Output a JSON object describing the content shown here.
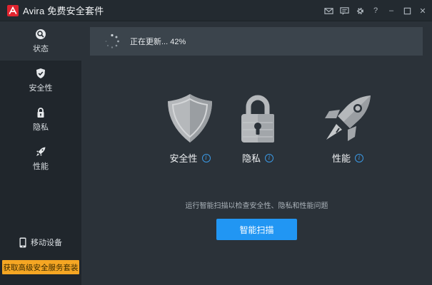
{
  "app": {
    "title": "Avira 免费安全套件",
    "brand_color": "#e0242f",
    "accent_color": "#2196f3"
  },
  "titlebar": {
    "controls": [
      "mail-icon",
      "chat-icon",
      "gear-icon",
      "help",
      "minimize",
      "maximize",
      "close"
    ],
    "help_label": "?",
    "minimize_label": "–",
    "close_label": "✕"
  },
  "sidebar": {
    "items": [
      {
        "label": "状态",
        "icon": "status-icon",
        "active": true
      },
      {
        "label": "安全性",
        "icon": "shield-check-icon",
        "active": false
      },
      {
        "label": "隐私",
        "icon": "lock-icon",
        "active": false
      },
      {
        "label": "性能",
        "icon": "rocket-icon",
        "active": false
      }
    ],
    "mobile_label": "移动设备",
    "upgrade_label": "获取高级安全服务套装"
  },
  "main": {
    "status_text": "正在更新... 42%",
    "progress_percent": 42,
    "features": [
      {
        "label": "安全性",
        "icon": "shield-icon"
      },
      {
        "label": "隐私",
        "icon": "padlock-icon"
      },
      {
        "label": "性能",
        "icon": "rocket-icon"
      }
    ],
    "hint": "运行智能扫描以检查安全性、隐私和性能问题",
    "scan_button_label": "智能扫描"
  }
}
